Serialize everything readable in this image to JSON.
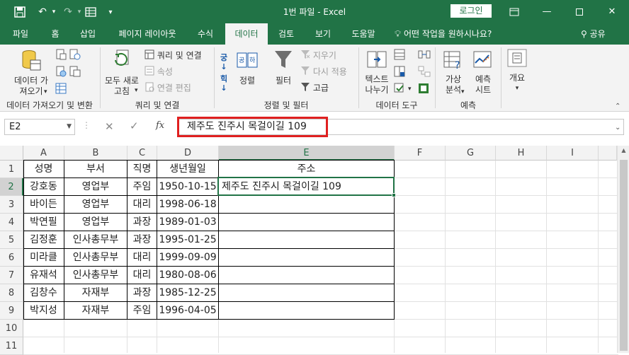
{
  "titlebar": {
    "title": "1번 파일  -  Excel",
    "login": "로그인",
    "icons": [
      "save-icon",
      "undo-icon",
      "redo-icon",
      "form-icon",
      "customize-icon"
    ]
  },
  "tabs": [
    "파일",
    "홈",
    "삽입",
    "페이지 레이아웃",
    "수식",
    "데이터",
    "검토",
    "보기",
    "도움말"
  ],
  "active_tab": "데이터",
  "tellme": "어떤 작업을 원하시나요?",
  "share": "공유",
  "ribbon": {
    "get_data": "데이터 가\n져오기",
    "refresh_all": "모두 새로\n고침",
    "queries_connections": "쿼리 및 연결",
    "properties": "속성",
    "edit_links": "연결 편집",
    "sort": "정렬",
    "filter": "필터",
    "clear": "지우기",
    "reapply": "다시 적용",
    "advanced": "고급",
    "text_to_columns": "텍스트\n나누기",
    "what_if": "가상\n분석",
    "forecast_sheet": "예측\n시트",
    "outline": "개요",
    "groups": {
      "get_transform": "데이터 가져오기 및 변환",
      "queries": "쿼리 및 연결",
      "sort_filter": "정렬 및 필터",
      "data_tools": "데이터 도구",
      "forecast": "예측"
    }
  },
  "formula_bar": {
    "name_box": "E2",
    "fx": "fx",
    "content": "제주도 진주시 목걸이길 109"
  },
  "sheet": {
    "columns": [
      "A",
      "B",
      "C",
      "D",
      "E",
      "F",
      "G",
      "H",
      "I"
    ],
    "rows": [
      "1",
      "2",
      "3",
      "4",
      "5",
      "6",
      "7",
      "8",
      "9",
      "10",
      "11"
    ],
    "header": [
      "성명",
      "부서",
      "직명",
      "생년월일",
      "주소"
    ],
    "data": [
      [
        "강호동",
        "영업부",
        "주임",
        "1950-10-15",
        "제주도 진주시 목걸이길 109"
      ],
      [
        "바이든",
        "영업부",
        "대리",
        "1998-06-18",
        ""
      ],
      [
        "박연필",
        "영업부",
        "과장",
        "1989-01-03",
        ""
      ],
      [
        "김정훈",
        "인사총무부",
        "과장",
        "1995-01-25",
        ""
      ],
      [
        "미라클",
        "인사총무부",
        "대리",
        "1999-09-09",
        ""
      ],
      [
        "유재석",
        "인사총무부",
        "대리",
        "1980-08-06",
        ""
      ],
      [
        "김창수",
        "자재부",
        "과장",
        "1985-12-25",
        ""
      ],
      [
        "박지성",
        "자재부",
        "주임",
        "1996-04-05",
        ""
      ]
    ],
    "selected_cell": "E2"
  }
}
